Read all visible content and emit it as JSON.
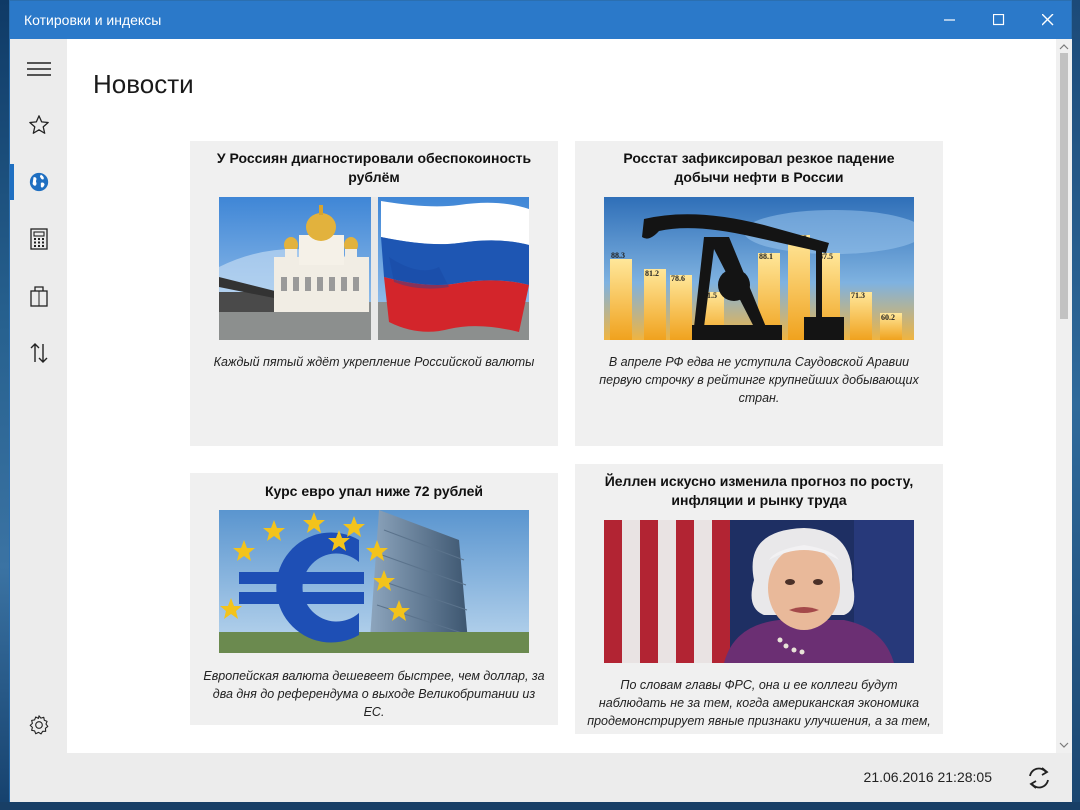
{
  "window": {
    "title": "Котировки и индексы",
    "accent": "#2b79c9"
  },
  "nav": {
    "items": [
      {
        "icon": "hamburger-menu-icon"
      },
      {
        "icon": "star-icon"
      },
      {
        "icon": "globe-icon",
        "active": true
      },
      {
        "icon": "calculator-icon"
      },
      {
        "icon": "briefcase-icon"
      },
      {
        "icon": "sort-arrows-icon"
      },
      {
        "icon": "gear-icon"
      }
    ]
  },
  "page": {
    "title": "Новости"
  },
  "news": [
    {
      "title": "У Россиян диагностировали обеспокоиность рублём",
      "desc": "Каждый пятый ждёт укрепление Российской валюты",
      "image": "cathedral-and-russian-flag"
    },
    {
      "title": "Росстат зафиксировал резкое падение добычи нефти в России",
      "desc": "В апреле РФ едва не уступила Саудовской Аравии первую строчку в рейтинге крупнейших добывающих стран.",
      "image": "oil-pump-chart",
      "chart_labels": [
        "88.3",
        "81.2",
        "78.6",
        "71.5",
        "88.1",
        "96.05",
        "87.5",
        "71.3",
        "60.2"
      ]
    },
    {
      "title": "Курс евро упал ниже 72 рублей",
      "desc": "Европейская валюта дешевеет быстрее, чем доллар, за два дня до референдума о выходе Великобритании из ЕС.",
      "image": "euro-sign-sculpture"
    },
    {
      "title": "Йеллен искусно изменила прогноз по росту, инфляции и рынку труда",
      "desc": "По словам главы ФРС, она и ее коллеги будут наблюдать не за тем, когда американская экономика продемонстрирует явные признаки улучшения, а за тем,",
      "image": "janet-yellen-portrait"
    }
  ],
  "status": {
    "timestamp": "21.06.2016 21:28:05"
  }
}
